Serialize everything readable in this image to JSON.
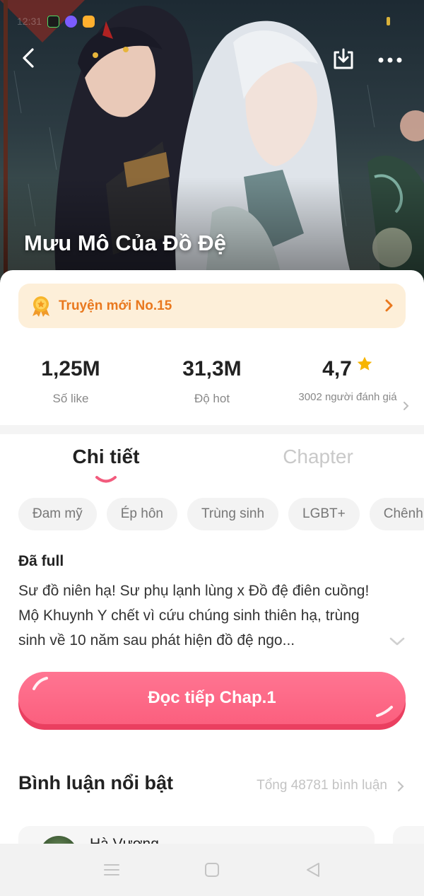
{
  "status_bar": {
    "time": "12:31",
    "icons": [
      "game-notification-icon",
      "messenger-icon",
      "photos-icon"
    ]
  },
  "header": {
    "back_icon": "chevron-left-icon",
    "download_icon": "download-icon",
    "more_icon": "more-dots-icon"
  },
  "comic": {
    "title": "Mưu Mô Của Đồ Đệ"
  },
  "rank_banner": {
    "label": "Truyện mới No.15",
    "icon": "medal-icon"
  },
  "stats": {
    "likes": {
      "value": "1,25M",
      "label": "Số like"
    },
    "hot": {
      "value": "31,3M",
      "label": "Độ hot"
    },
    "rating": {
      "value": "4,7",
      "label": "3002 người đánh giá"
    }
  },
  "tabs": {
    "details": "Chi tiết",
    "chapter": "Chapter"
  },
  "tags": [
    "Đam mỹ",
    "Ép hôn",
    "Trùng sinh",
    "LGBT+",
    "Chênh"
  ],
  "description": {
    "status": "Đã full",
    "synopsis": "Sư đồ niên hạ! Sư phụ lạnh lùng x Đồ đệ điên cuồng! Mộ Khuynh Y chết vì cứu chúng sinh thiên hạ, trùng sinh về 10 năm sau phát hiện đồ đệ ngo..."
  },
  "read_button": {
    "label": "Đọc tiếp Chap.1"
  },
  "comments": {
    "title": "Bình luận nổi bật",
    "total": "Tổng 48781 bình luận",
    "first_commenter": "Hà Vương"
  },
  "colors": {
    "accent": "#fb5f7e",
    "rank_text": "#e9781e",
    "rank_bg": "#fdefd9",
    "star": "#f7b500"
  }
}
